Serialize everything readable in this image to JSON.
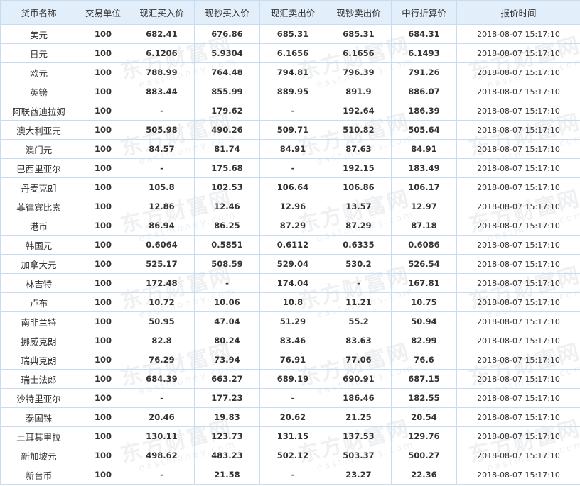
{
  "watermark": {
    "cn": "东方财富网",
    "en": "eastmoney.com"
  },
  "headers": [
    "货币名称",
    "交易单位",
    "现汇买入价",
    "现钞买入价",
    "现汇卖出价",
    "现钞卖出价",
    "中行折算价",
    "报价时间"
  ],
  "rows": [
    [
      "美元",
      "100",
      "682.41",
      "676.86",
      "685.31",
      "685.31",
      "684.31",
      "2018-08-07  15:17:10"
    ],
    [
      "日元",
      "100",
      "6.1206",
      "5.9304",
      "6.1656",
      "6.1656",
      "6.1493",
      "2018-08-07  15:17:10"
    ],
    [
      "欧元",
      "100",
      "788.99",
      "764.48",
      "794.81",
      "796.39",
      "791.26",
      "2018-08-07  15:17:10"
    ],
    [
      "英镑",
      "100",
      "883.44",
      "855.99",
      "889.95",
      "891.9",
      "886.07",
      "2018-08-07  15:17:10"
    ],
    [
      "阿联酋迪拉姆",
      "100",
      "-",
      "179.62",
      "-",
      "192.64",
      "186.39",
      "2018-08-07  15:17:10"
    ],
    [
      "澳大利亚元",
      "100",
      "505.98",
      "490.26",
      "509.71",
      "510.82",
      "505.64",
      "2018-08-07  15:17:10"
    ],
    [
      "澳门元",
      "100",
      "84.57",
      "81.74",
      "84.91",
      "87.63",
      "84.91",
      "2018-08-07  15:17:10"
    ],
    [
      "巴西里亚尔",
      "100",
      "-",
      "175.68",
      "-",
      "192.15",
      "183.49",
      "2018-08-07  15:17:10"
    ],
    [
      "丹麦克朗",
      "100",
      "105.8",
      "102.53",
      "106.64",
      "106.86",
      "106.17",
      "2018-08-07  15:17:10"
    ],
    [
      "菲律宾比索",
      "100",
      "12.86",
      "12.46",
      "12.96",
      "13.57",
      "12.97",
      "2018-08-07  15:17:10"
    ],
    [
      "港币",
      "100",
      "86.94",
      "86.25",
      "87.29",
      "87.29",
      "87.18",
      "2018-08-07  15:17:10"
    ],
    [
      "韩国元",
      "100",
      "0.6064",
      "0.5851",
      "0.6112",
      "0.6335",
      "0.6086",
      "2018-08-07  15:17:10"
    ],
    [
      "加拿大元",
      "100",
      "525.17",
      "508.59",
      "529.04",
      "530.2",
      "526.54",
      "2018-08-07  15:17:10"
    ],
    [
      "林吉特",
      "100",
      "172.48",
      "-",
      "174.04",
      "-",
      "167.81",
      "2018-08-07  15:17:10"
    ],
    [
      "卢布",
      "100",
      "10.72",
      "10.06",
      "10.8",
      "11.21",
      "10.75",
      "2018-08-07  15:17:10"
    ],
    [
      "南非兰特",
      "100",
      "50.95",
      "47.04",
      "51.29",
      "55.2",
      "50.94",
      "2018-08-07  15:17:10"
    ],
    [
      "挪威克朗",
      "100",
      "82.8",
      "80.24",
      "83.46",
      "83.63",
      "82.99",
      "2018-08-07  15:17:10"
    ],
    [
      "瑞典克朗",
      "100",
      "76.29",
      "73.94",
      "76.91",
      "77.06",
      "76.6",
      "2018-08-07  15:17:10"
    ],
    [
      "瑞士法郎",
      "100",
      "684.39",
      "663.27",
      "689.19",
      "690.91",
      "687.15",
      "2018-08-07  15:17:10"
    ],
    [
      "沙特里亚尔",
      "100",
      "-",
      "177.23",
      "-",
      "186.46",
      "182.55",
      "2018-08-07  15:17:10"
    ],
    [
      "泰国铢",
      "100",
      "20.46",
      "19.83",
      "20.62",
      "21.25",
      "20.54",
      "2018-08-07  15:17:10"
    ],
    [
      "土耳其里拉",
      "100",
      "130.11",
      "123.73",
      "131.15",
      "137.53",
      "129.76",
      "2018-08-07  15:17:10"
    ],
    [
      "新加坡元",
      "100",
      "498.62",
      "483.23",
      "502.12",
      "503.37",
      "500.27",
      "2018-08-07  15:17:10"
    ],
    [
      "新台币",
      "100",
      "-",
      "21.58",
      "-",
      "23.27",
      "22.36",
      "2018-08-07  15:17:10"
    ]
  ]
}
